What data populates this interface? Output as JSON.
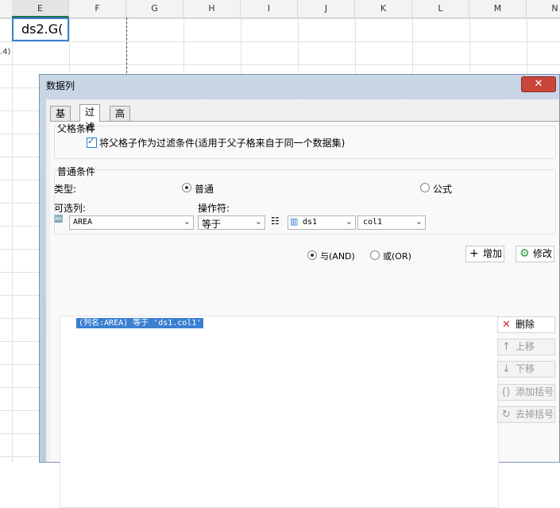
{
  "sheet": {
    "columns": [
      "E",
      "F",
      "G",
      "H",
      "I",
      "J",
      "K",
      "L",
      "M",
      "N"
    ],
    "active_cell_text": "ds2.G(",
    "row_stub_text": ".4)"
  },
  "dialog": {
    "title": "数据列",
    "close_symbol": "✕",
    "tabs": [
      "基本",
      "过滤",
      "高级"
    ],
    "active_tab": "过滤",
    "parent_group": {
      "title": "父格条件",
      "checkbox_label": "将父格子作为过滤条件(适用于父子格来自于同一个数据集)",
      "checked": true
    },
    "normal_group": {
      "title": "普通条件",
      "type_label": "类型:",
      "type_normal": "普通",
      "type_formula": "公式",
      "column_label": "可选列:",
      "operator_label": "操作符:",
      "column_value": "AREA",
      "operator_value": "等于",
      "dataset_value": "ds1",
      "field_value": "col1"
    },
    "logic": {
      "and": "与(AND)",
      "or": "或(OR)"
    },
    "buttons": {
      "add": "增加",
      "modify": "修改",
      "delete": "删除",
      "up": "上移",
      "down": "下移",
      "add_bracket": "添加括号",
      "remove_bracket": "去掉括号"
    },
    "conditions": [
      "(列名:AREA) 等于 'ds1.col1'"
    ]
  },
  "colors": {
    "accent": "#3b7fd1",
    "close": "#c9453a",
    "delete_icon": "#d62a2a"
  }
}
